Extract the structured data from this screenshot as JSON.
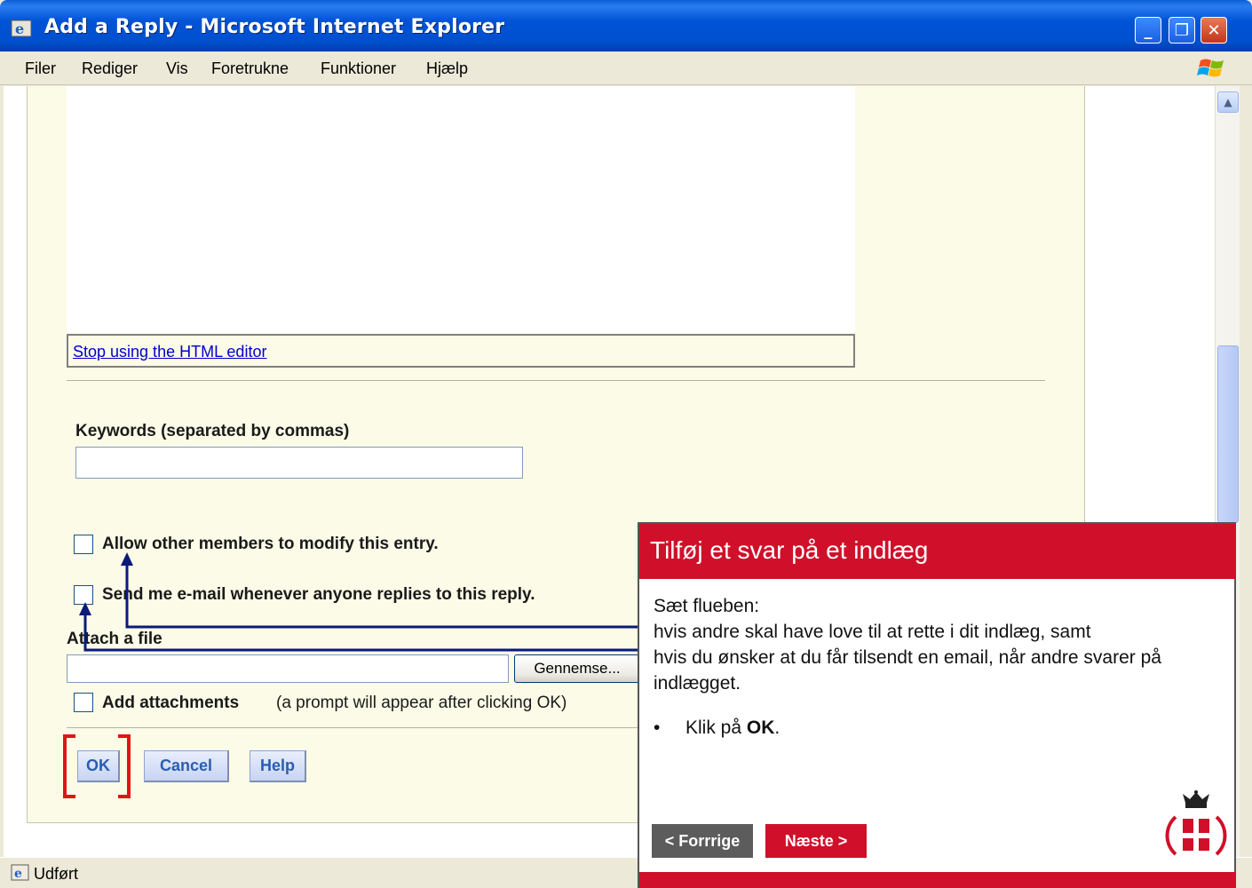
{
  "window": {
    "title": "Add a Reply - Microsoft Internet Explorer",
    "minimize": "_",
    "maximize": "❐",
    "close": "✕"
  },
  "menu": [
    "Filer",
    "Rediger",
    "Vis",
    "Foretrukne",
    "Funktioner",
    "Hjælp"
  ],
  "form": {
    "html_editor_link": "Stop using the HTML editor",
    "keywords_label": "Keywords (separated by commas)",
    "keywords_value": "",
    "allow_modify_label": "Allow other members to modify this entry.",
    "send_email_label": "Send me e-mail whenever anyone replies to this reply.",
    "attach_label": "Attach a file",
    "file_value": "",
    "browse_label": "Gennemse...",
    "add_attachments_label": "Add attachments",
    "add_attachments_note": "(a prompt will appear after clicking OK)",
    "ok_label": "OK",
    "cancel_label": "Cancel",
    "help_label": "Help"
  },
  "status": {
    "text": "Udført"
  },
  "callout": {
    "title": "Tilføj et svar på et indlæg",
    "line1": "Sæt flueben:",
    "line2": "hvis andre skal have love til at rette i dit indlæg, samt",
    "line3": "hvis du ønsker at du får tilsendt en email, når andre svarer på indlægget.",
    "bullet_prefix": "Klik på ",
    "bullet_bold": "OK",
    "bullet_suffix": ".",
    "prev_label": "< Forrrige",
    "next_label": "Næste >",
    "accent_color": "#d0102a"
  },
  "icons": {
    "ie_icon": "ie-logo-icon",
    "windows_logo": "windows-flag-icon",
    "crown_logo": "crown-cross-logo-icon",
    "scroll_up": "chevron-up-icon"
  }
}
